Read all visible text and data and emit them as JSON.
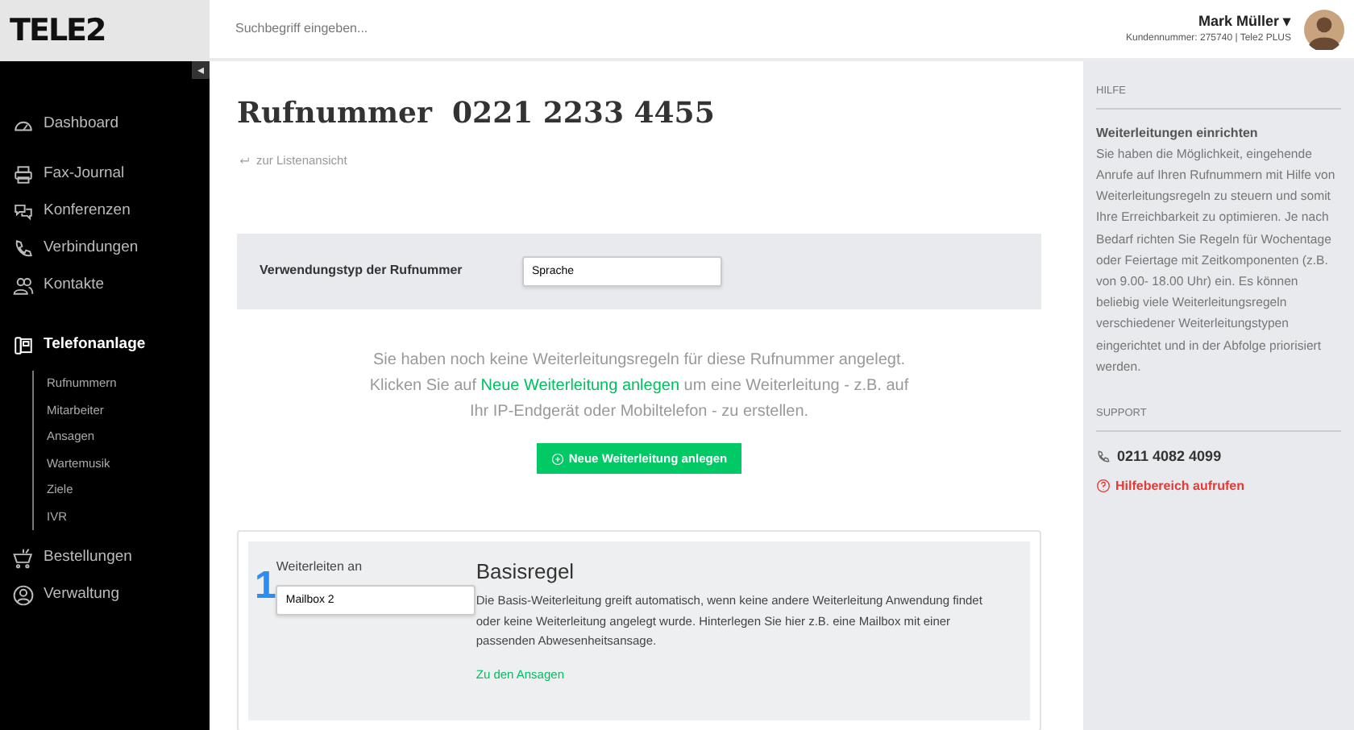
{
  "header": {
    "logo": "TELE2",
    "search": {
      "placeholder": "Suchbegriff eingeben..."
    },
    "user": {
      "name": "Mark Müller",
      "caret": "▾",
      "customer": "Kundennummer: 275740 | Tele2 PLUS"
    }
  },
  "sidebar": {
    "collapse": "◂",
    "items": [
      {
        "label": "Dashboard",
        "selected": false
      },
      {
        "label": "Fax-Journal",
        "selected": false
      },
      {
        "label": "Konferenzen",
        "selected": false
      },
      {
        "label": "Verbindungen",
        "selected": false
      },
      {
        "label": "Kontakte",
        "selected": false
      },
      {
        "label": "Telefonanlage",
        "selected": true,
        "children": [
          {
            "label": "Rufnummern",
            "selected": false
          },
          {
            "label": "Mitarbeiter",
            "selected": false
          },
          {
            "label": "Ansagen",
            "selected": false
          },
          {
            "label": "Wartemusik",
            "selected": false
          },
          {
            "label": "Ziele",
            "selected": false
          },
          {
            "label": "IVR",
            "selected": false
          }
        ]
      },
      {
        "label": "Bestellungen",
        "selected": false
      },
      {
        "label": "Verwaltung",
        "selected": false
      }
    ]
  },
  "main": {
    "title": "Rufnummer  0221 2233 4455",
    "back_link": "zur Listenansicht",
    "usage": {
      "label": "Verwendungstyp der Rufnummer",
      "value": "Sprache"
    },
    "message": {
      "before": "Sie haben noch keine Weiterleitungsregeln für diese Rufnummer angelegt. Klicken Sie auf ",
      "link": "Neue Weiterleitung anlegen",
      "after": " um eine Weiterleitung - z.B. auf Ihr IP-Endgerät oder Mobiltelefon - zu erstellen."
    },
    "new_button": "Neue Weiterleitung anlegen",
    "rule": {
      "number": "1",
      "field_label": "Weiterleiten an",
      "value": "Mailbox 2",
      "title": "Basisregel",
      "text": "Die Basis-Weiterleitung greift automatisch, wenn keine andere Weiterleitung Anwendung findet oder keine Weiterleitung angelegt wurde. Hinterlegen Sie hier z.B. eine Mailbox mit einer passenden Abwesenheitsansage.",
      "link": "Zu den Ansagen"
    }
  },
  "help": {
    "heading": "HILFE",
    "title": "Weiterleitungen einrichten",
    "text": "Sie haben die Möglichkeit, eingehende Anrufe auf Ihren Rufnummern mit Hilfe von Weiterleitungsregeln zu steuern und somit Ihre Erreichbarkeit zu optimieren. Je nach Bedarf richten Sie Regeln für Wochentage oder Feiertage mit Zeitkomponenten (z.B. von 9.00- 18.00 Uhr) ein. Es können beliebig viele Weiterleitungsregeln verschiedener Weiterleitungstypen eingerichtet und in der Abfolge priorisiert werden.",
    "support_heading": "SUPPORT",
    "phone": "0211 4082 4099",
    "help_link": "Hilfebereich aufrufen"
  }
}
